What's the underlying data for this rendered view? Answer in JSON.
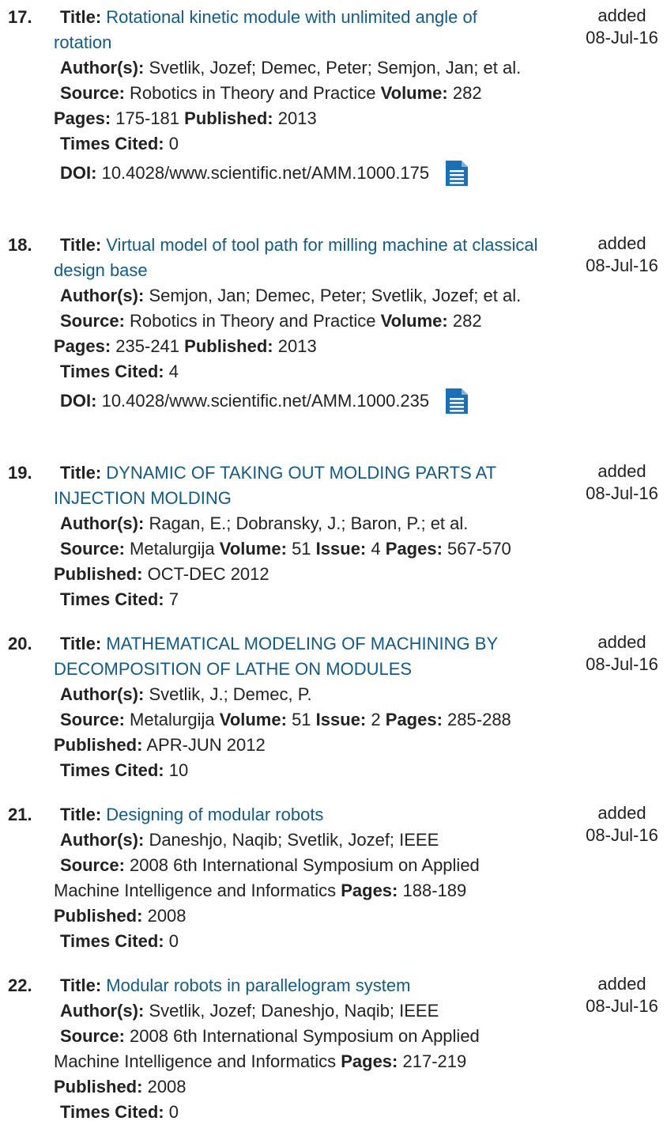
{
  "labels": {
    "title": "Title:",
    "authors": "Author(s):",
    "source": "Source:",
    "volume": "Volume:",
    "issue": "Issue:",
    "pages": "Pages:",
    "published": "Published:",
    "times_cited": "Times Cited:",
    "doi": "DOI:",
    "added": "added"
  },
  "records": [
    {
      "num": "17.",
      "title": "Rotational kinetic module with unlimited angle of rotation",
      "authors": "Svetlik, Jozef; Demec, Peter; Semjon, Jan; et al.",
      "source": "Robotics in Theory and Practice",
      "volume": "282",
      "pages": "175-181",
      "published": "2013",
      "times_cited": "0",
      "doi": "10.4028/www.scientific.net/AMM.1000.175",
      "date": "08-Jul-16",
      "icon": "document-icon"
    },
    {
      "num": "18.",
      "title": "Virtual model of tool path for milling machine at classical design base",
      "authors": "Semjon, Jan; Demec, Peter; Svetlik, Jozef; et al.",
      "source": "Robotics in Theory and Practice",
      "volume": "282",
      "pages": "235-241",
      "published": "2013",
      "times_cited": "4",
      "doi": "10.4028/www.scientific.net/AMM.1000.235",
      "date": "08-Jul-16",
      "icon": "document-icon"
    },
    {
      "num": "19.",
      "title": "DYNAMIC OF TAKING OUT MOLDING PARTS AT INJECTION MOLDING",
      "authors": "Ragan, E.; Dobransky, J.; Baron, P.; et al.",
      "source": "Metalurgija",
      "volume": "51",
      "issue": "4",
      "pages": "567-570",
      "published": "OCT-DEC 2012",
      "times_cited": "7",
      "date": "08-Jul-16"
    },
    {
      "num": "20.",
      "title": "MATHEMATICAL MODELING OF MACHINING BY DECOMPOSITION OF LATHE ON MODULES",
      "authors": "Svetlik, J.; Demec, P.",
      "source": "Metalurgija",
      "volume": "51",
      "issue": "2",
      "pages": "285-288",
      "published": "APR-JUN 2012",
      "times_cited": "10",
      "date": "08-Jul-16"
    },
    {
      "num": "21.",
      "title": "Designing of modular robots",
      "authors": "Daneshjo, Naqib; Svetlik, Jozef; IEEE",
      "source": "2008 6th International Symposium on Applied Machine Intelligence and Informatics",
      "pages": "188-189",
      "published": "2008",
      "times_cited": "0",
      "date": "08-Jul-16"
    },
    {
      "num": "22.",
      "title": "Modular robots in parallelogram system",
      "authors": "Svetlik, Jozef; Daneshjo, Naqib; IEEE",
      "source": "2008 6th International Symposium on Applied Machine Intelligence and Informatics",
      "pages": "217-219",
      "published": "2008",
      "times_cited": "0",
      "date": "08-Jul-16"
    }
  ],
  "colors": {
    "link": "#135a85",
    "text": "#222222",
    "icon": "#1a6fb5"
  }
}
